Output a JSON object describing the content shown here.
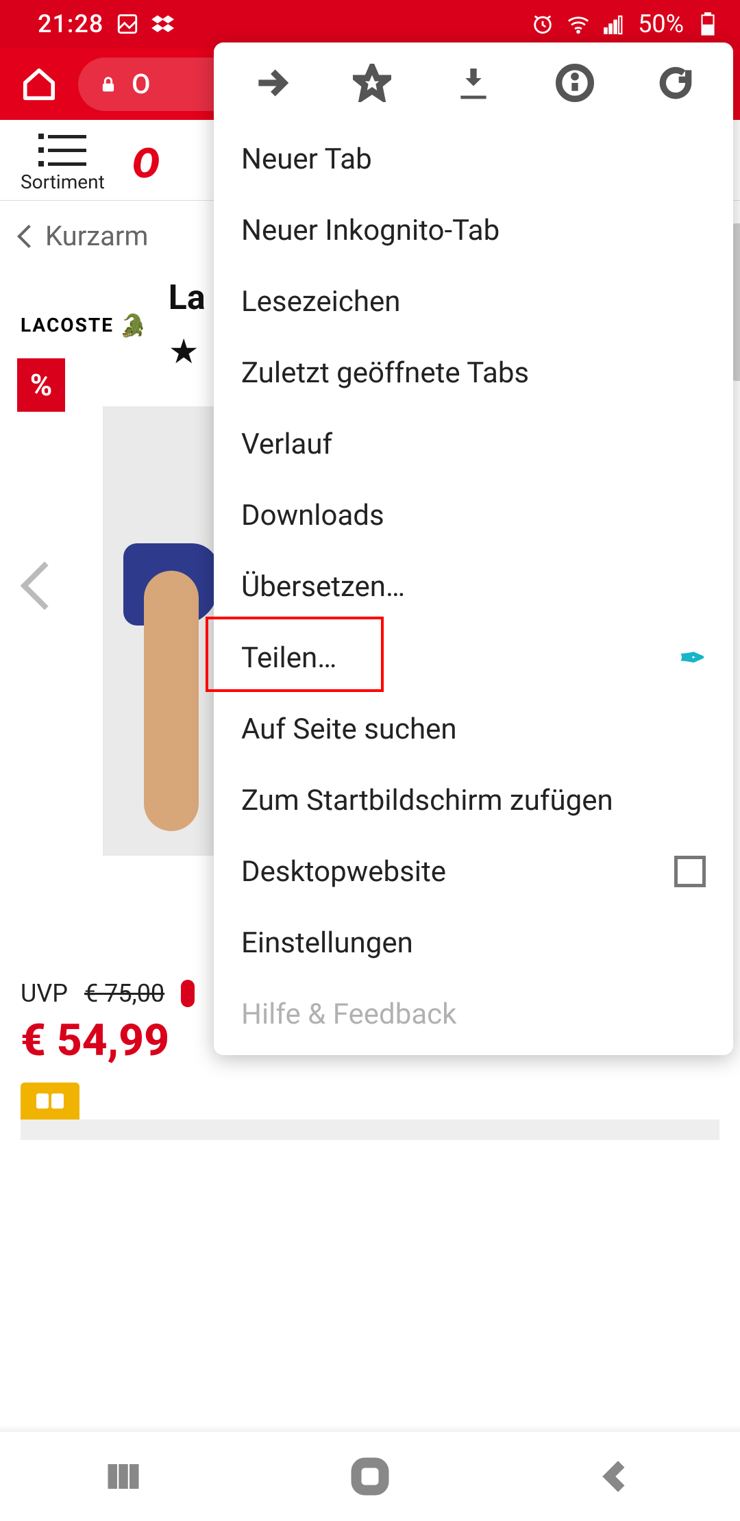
{
  "statusbar": {
    "time": "21:28",
    "battery_text": "50%"
  },
  "browser": {
    "url_fragment": "O"
  },
  "page": {
    "sortiment_label": "Sortiment",
    "logo_text": "O",
    "breadcrumb": "Kurzarm",
    "brand_mark": "LACOSTE",
    "product_title_fragment": "La",
    "discount_symbol": "%",
    "uvp_label": "UVP",
    "uvp_old": "€ 75,00",
    "price_current": "€ 54,99"
  },
  "menu": {
    "items": {
      "new_tab": "Neuer Tab",
      "incognito": "Neuer Inkognito-Tab",
      "bookmarks": "Lesezeichen",
      "recent_tabs": "Zuletzt geöffnete Tabs",
      "history": "Verlauf",
      "downloads": "Downloads",
      "translate": "Übersetzen…",
      "share": "Teilen…",
      "find": "Auf Seite suchen",
      "add_home": "Zum Startbildschirm zufügen",
      "desktop_site": "Desktopwebsite",
      "settings": "Einstellungen",
      "help": "Hilfe & Feedback"
    }
  }
}
